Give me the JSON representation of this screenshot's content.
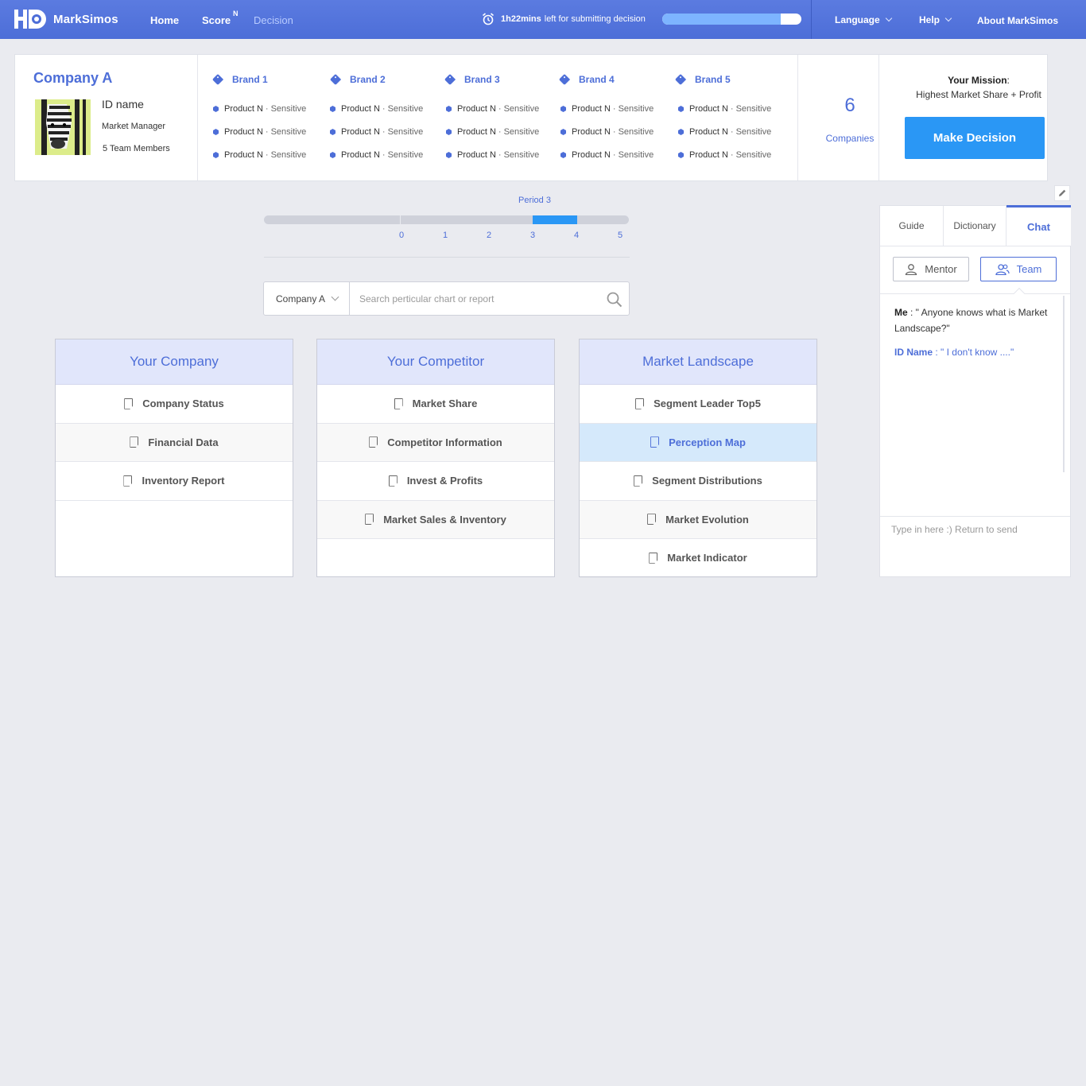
{
  "header": {
    "app_name": "MarkSimos",
    "nav": [
      "Home",
      "Score",
      "Decision"
    ],
    "score_badge": "N",
    "timer_bold": "1h22mins",
    "timer_text": "left for submitting decision",
    "timer_progress": 0.85,
    "language": "Language",
    "help": "Help",
    "about": "About MarkSimos"
  },
  "company": {
    "name": "Company A",
    "user_id": "ID name",
    "role": "Market Manager",
    "team": "5 Team Members"
  },
  "brands": [
    {
      "name": "Brand 1",
      "products": [
        {
          "name": "Product N",
          "type": "Sensitive"
        },
        {
          "name": "Product N",
          "type": "Sensitive"
        },
        {
          "name": "Product N",
          "type": "Sensitive"
        }
      ]
    },
    {
      "name": "Brand 2",
      "products": [
        {
          "name": "Product N",
          "type": "Sensitive"
        },
        {
          "name": "Product N",
          "type": "Sensitive"
        },
        {
          "name": "Product N",
          "type": "Sensitive"
        }
      ]
    },
    {
      "name": "Brand 3",
      "products": [
        {
          "name": "Product N",
          "type": "Sensitive"
        },
        {
          "name": "Product N",
          "type": "Sensitive"
        },
        {
          "name": "Product N",
          "type": "Sensitive"
        }
      ]
    },
    {
      "name": "Brand 4",
      "products": [
        {
          "name": "Product N",
          "type": "Sensitive"
        },
        {
          "name": "Product N",
          "type": "Sensitive"
        },
        {
          "name": "Product N",
          "type": "Sensitive"
        }
      ]
    },
    {
      "name": "Brand 5",
      "products": [
        {
          "name": "Product N",
          "type": "Sensitive"
        },
        {
          "name": "Product N",
          "type": "Sensitive"
        },
        {
          "name": "Product N",
          "type": "Sensitive"
        }
      ]
    }
  ],
  "companies": {
    "count": "6",
    "label": "Companies"
  },
  "mission": {
    "title": "Your Mission",
    "colon": ":",
    "text": "Highest Market Share + Profit",
    "button": "Make Decision"
  },
  "period": {
    "label": "Period 3",
    "numbers": [
      "0",
      "1",
      "2",
      "3",
      "4",
      "5"
    ],
    "selected": 3
  },
  "search": {
    "company_select": "Company A",
    "placeholder": "Search perticular chart or report"
  },
  "columns": [
    {
      "title": "Your Company",
      "items": [
        "Company Status",
        "Financial Data",
        "Inventory Report"
      ]
    },
    {
      "title": "Your Competitor",
      "items": [
        "Market Share",
        "Competitor Information",
        "Invest & Profits",
        "Market Sales & Inventory"
      ]
    },
    {
      "title": "Market Landscape",
      "items": [
        "Segment Leader Top5",
        "Perception Map",
        "Segment Distributions",
        "Market Evolution",
        "Market Indicator"
      ],
      "selected": 1
    }
  ],
  "chat": {
    "tabs": [
      "Guide",
      "Dictionary",
      "Chat"
    ],
    "active_tab": "Chat",
    "buttons": [
      "Mentor",
      "Team"
    ],
    "messages": [
      {
        "sender": "Me",
        "text": " : \" Anyone knows what is Market Landscape?\""
      },
      {
        "sender": "ID Name",
        "text": " : \" I don't know ....\""
      }
    ],
    "input_placeholder": "Type in here :) Return to send"
  },
  "colors": {
    "accent": "#4d6ed8",
    "button_blue": "#2a97f5",
    "selected_row": "#d5e9fb",
    "column_header": "#e1e6fb"
  }
}
